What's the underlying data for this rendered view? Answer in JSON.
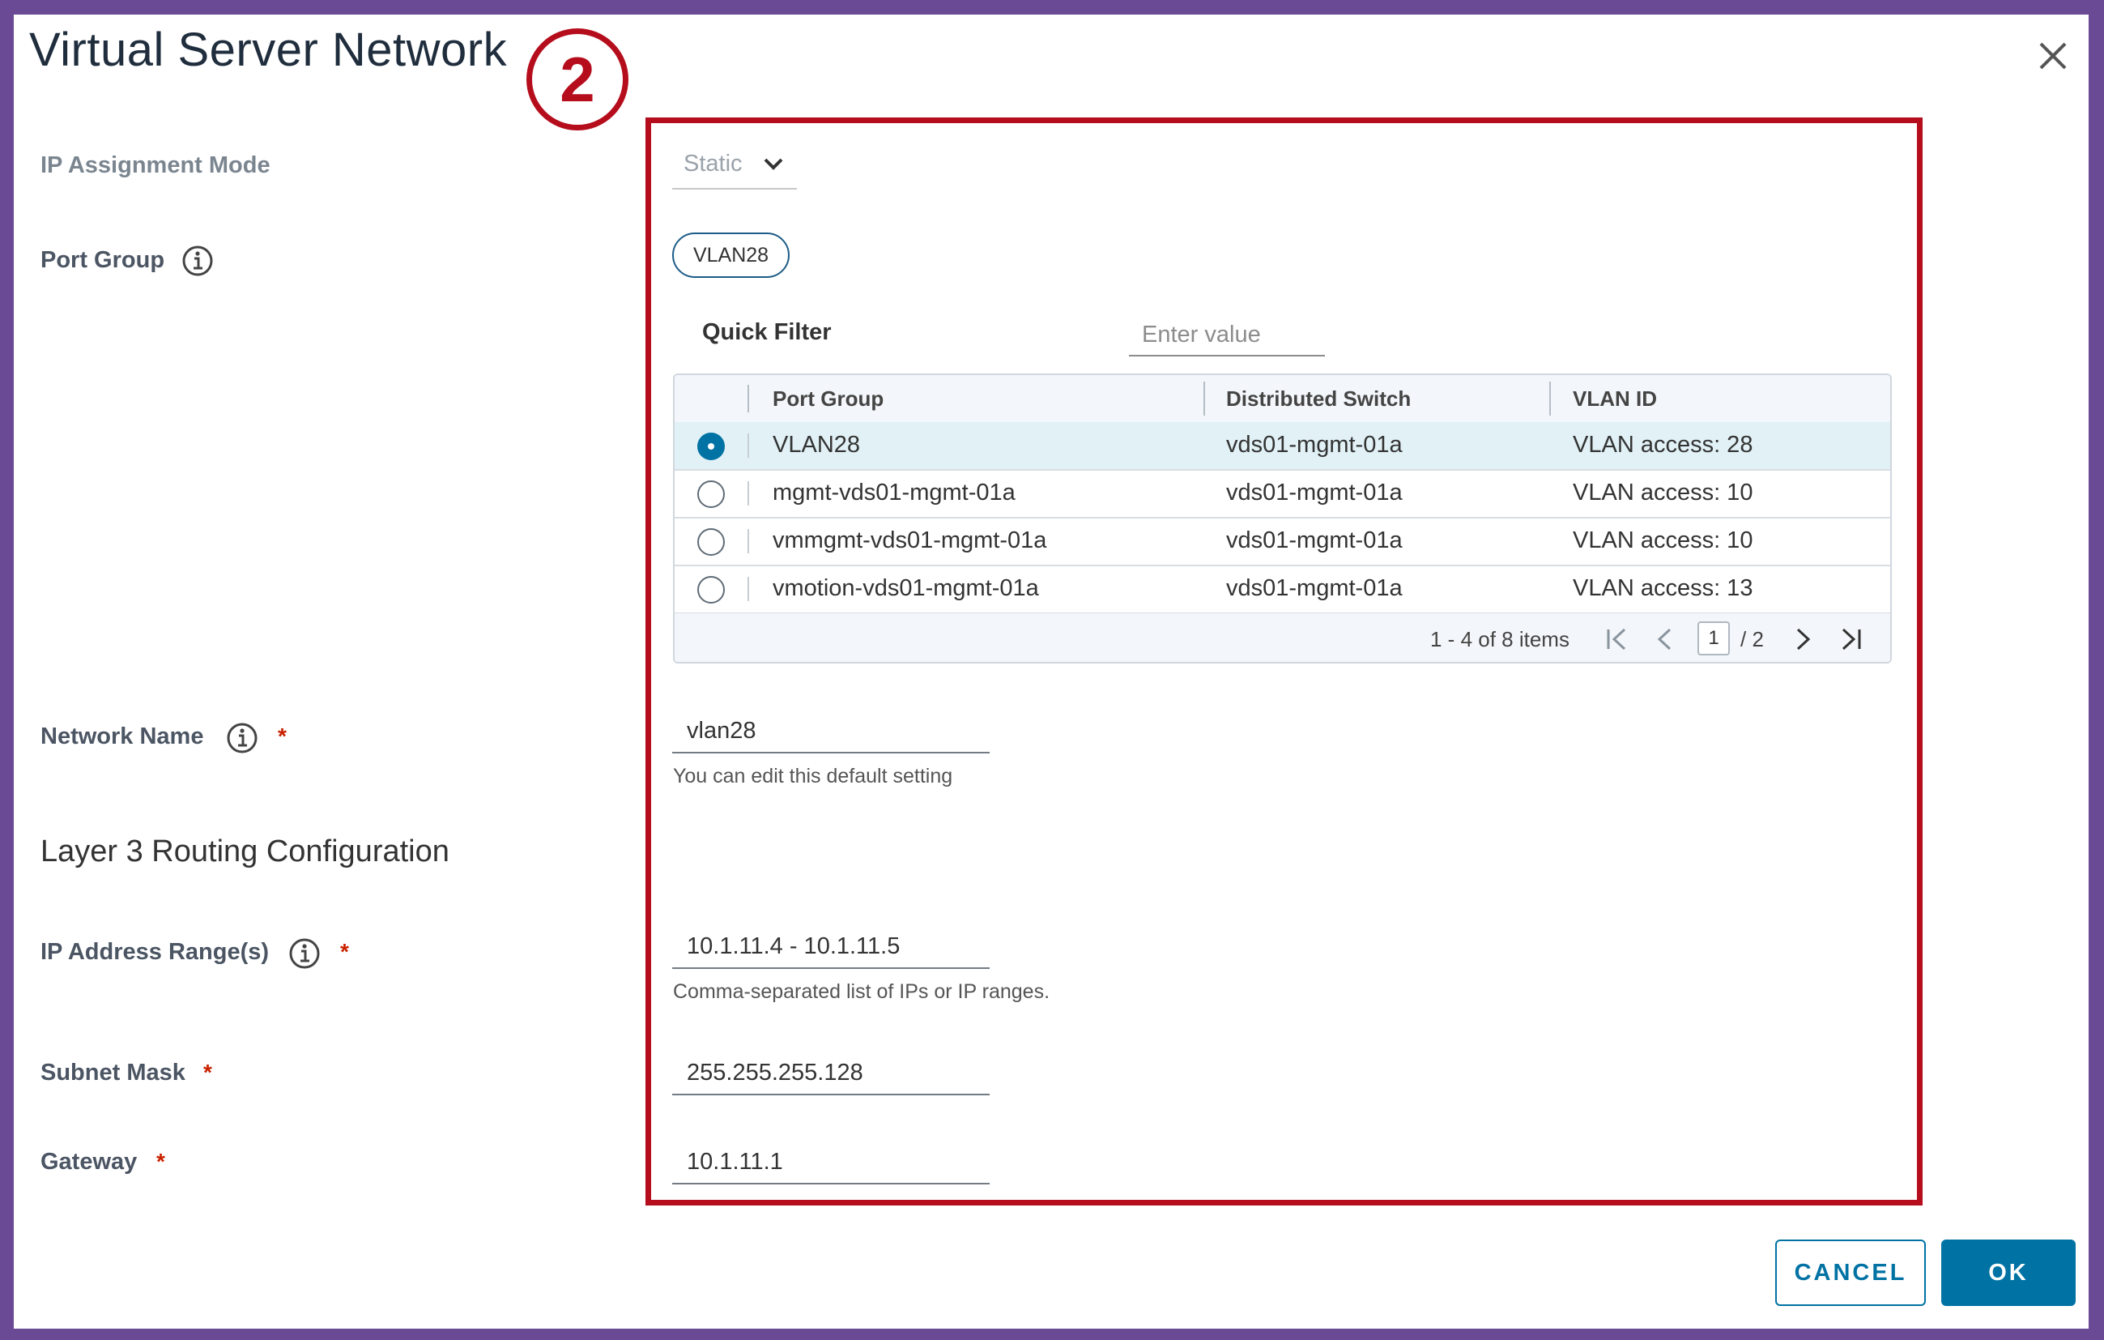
{
  "dialog": {
    "title": "Virtual Server Network",
    "close_icon": "close-icon"
  },
  "annotation": {
    "step_number": "2",
    "color": "#b50d1c"
  },
  "form": {
    "ip_assignment_mode": {
      "label": "IP Assignment Mode",
      "value": "Static"
    },
    "port_group": {
      "label": "Port Group",
      "selected_chip": "VLAN28",
      "quick_filter_label": "Quick Filter",
      "quick_filter_placeholder": "Enter value",
      "columns": [
        "Port Group",
        "Distributed Switch",
        "VLAN ID"
      ],
      "rows": [
        {
          "port_group": "VLAN28",
          "switch": "vds01-mgmt-01a",
          "vlan": "VLAN access: 28",
          "selected": true
        },
        {
          "port_group": "mgmt-vds01-mgmt-01a",
          "switch": "vds01-mgmt-01a",
          "vlan": "VLAN access: 10",
          "selected": false
        },
        {
          "port_group": "vmmgmt-vds01-mgmt-01a",
          "switch": "vds01-mgmt-01a",
          "vlan": "VLAN access: 10",
          "selected": false
        },
        {
          "port_group": "vmotion-vds01-mgmt-01a",
          "switch": "vds01-mgmt-01a",
          "vlan": "VLAN access: 13",
          "selected": false
        }
      ],
      "pagination": {
        "summary": "1 - 4 of 8 items",
        "current_page": "1",
        "total_pages": "/ 2"
      }
    },
    "network_name": {
      "label": "Network Name",
      "value": "vlan28",
      "helper": "You can edit this default setting"
    },
    "layer3_title": "Layer 3 Routing Configuration",
    "ip_range": {
      "label": "IP Address Range(s)",
      "value": "10.1.11.4 - 10.1.11.5",
      "helper": "Comma-separated list of IPs or IP ranges."
    },
    "subnet_mask": {
      "label": "Subnet Mask",
      "value": "255.255.255.128"
    },
    "gateway": {
      "label": "Gateway",
      "value": "10.1.11.1"
    },
    "required_marker": "*"
  },
  "actions": {
    "cancel_label": "CANCEL",
    "ok_label": "OK"
  },
  "colors": {
    "primary": "#0072a3",
    "frame": "#6a4a94",
    "required": "#c92100"
  }
}
